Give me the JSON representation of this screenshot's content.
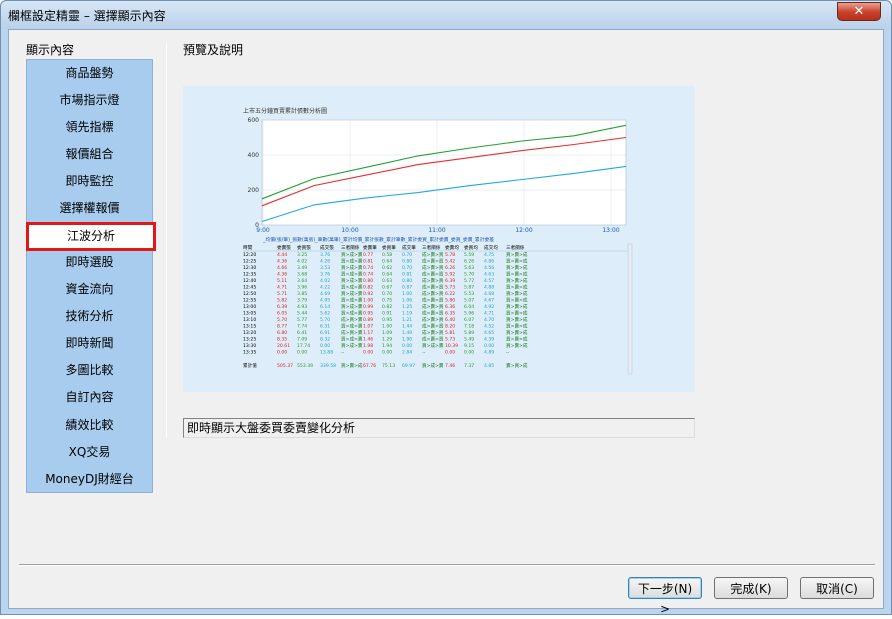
{
  "window": {
    "title": "欄框設定精靈 – 選擇顯示內容",
    "close_glyph": "✕"
  },
  "left_panel": {
    "label": "顯示內容",
    "items": [
      {
        "label": "商品盤勢"
      },
      {
        "label": "市場指示燈"
      },
      {
        "label": "領先指標"
      },
      {
        "label": "報價組合"
      },
      {
        "label": "即時監控"
      },
      {
        "label": "選擇權報價"
      },
      {
        "label": "江波分析",
        "selected": true
      },
      {
        "label": "即時選股"
      },
      {
        "label": "資金流向"
      },
      {
        "label": "技術分析"
      },
      {
        "label": "即時新聞"
      },
      {
        "label": "多圖比較"
      },
      {
        "label": "自訂內容"
      },
      {
        "label": "績效比較"
      },
      {
        "label": "XQ交易"
      },
      {
        "label": "MoneyDJ財經台"
      }
    ]
  },
  "right_panel": {
    "label": "預覽及說明",
    "description": "即時顯示大盤委買委賣變化分析"
  },
  "preview": {
    "title": "上市五分鐘買賣累計張數分析圖",
    "legend_text": "_均價(張/筆)_張數(萬張)_筆數(萬筆)_累計均價_累計張數_累計筆數_累計委買_累計委賣_委買_委賣_累計委差",
    "chart_data": {
      "type": "line",
      "x": [
        "9:00",
        "10:00",
        "11:00",
        "12:00",
        "13:00"
      ],
      "ylim": [
        0,
        600
      ],
      "yticks": [
        0,
        200,
        400,
        600
      ],
      "series": [
        {
          "color": "#22a033",
          "values": [
            150,
            265,
            330,
            395,
            440,
            480,
            510,
            570
          ]
        },
        {
          "color": "#e82c2c",
          "values": [
            110,
            225,
            285,
            345,
            385,
            425,
            460,
            500
          ]
        },
        {
          "color": "#22a8e0",
          "values": [
            20,
            115,
            155,
            185,
            225,
            260,
            295,
            335
          ]
        }
      ]
    },
    "table": {
      "headers": [
        "時間",
        "委賣張",
        "委買張",
        "成交張",
        "三者關係",
        "委賣筆",
        "委買筆",
        "成交筆",
        "三者關係",
        "委賣均",
        "委買均",
        "成交均",
        "三者關係"
      ],
      "rows": [
        [
          "12:20",
          "4.44",
          "3.25",
          "3.76",
          "買>成>賣",
          "0.77",
          "0.58",
          "0.70",
          "成>賣>買",
          "5.78",
          "5.59",
          "4.75",
          "買>賣>成"
        ],
        [
          "12:25",
          "4.36",
          "4.02",
          "4.26",
          "買>成>賣",
          "0.81",
          "0.64",
          "0.80",
          "成>賣>買",
          "5.42",
          "6.26",
          "4.86",
          "買>賣>成"
        ],
        [
          "12:30",
          "4.66",
          "3.49",
          "3.53",
          "買>成>賣",
          "0.74",
          "0.62",
          "0.70",
          "成>賣>買",
          "6.26",
          "5.63",
          "4.56",
          "買>賣>成"
        ],
        [
          "12:35",
          "4.36",
          "3.68",
          "3.76",
          "買>成>賣",
          "0.74",
          "0.64",
          "0.81",
          "成>賣>買",
          "5.92",
          "5.70",
          "4.63",
          "買>賣>成"
        ],
        [
          "12:40",
          "5.11",
          "3.64",
          "4.02",
          "買>成>賣",
          "0.80",
          "0.63",
          "0.80",
          "成>賣>買",
          "6.39",
          "5.77",
          "4.57",
          "買>賣>成"
        ],
        [
          "12:45",
          "4.71",
          "3.96",
          "4.22",
          "買>成>賣",
          "0.82",
          "0.67",
          "0.87",
          "成>賣>買",
          "5.73",
          "5.87",
          "4.88",
          "買>賣>成"
        ],
        [
          "12:50",
          "5.71",
          "3.85",
          "4.69",
          "買>成>賣",
          "0.92",
          "0.70",
          "1.00",
          "成>賣>買",
          "6.22",
          "5.53",
          "4.68",
          "買>賣>成"
        ],
        [
          "12:55",
          "5.82",
          "3.79",
          "4.95",
          "買>成>賣",
          "1.00",
          "0.75",
          "1.06",
          "成>賣>買",
          "5.80",
          "5.07",
          "4.67",
          "買>賣>成"
        ],
        [
          "13:00",
          "6.39",
          "4.93",
          "6.14",
          "買>成>賣",
          "0.99",
          "0.82",
          "1.25",
          "成>賣>買",
          "6.36",
          "6.04",
          "4.92",
          "買>賣>成"
        ],
        [
          "13:05",
          "6.05",
          "5.44",
          "5.62",
          "買>成>賣",
          "0.95",
          "0.91",
          "1.19",
          "成>賣>買",
          "6.35",
          "5.96",
          "4.71",
          "買>賣>成"
        ],
        [
          "13:10",
          "5.70",
          "5.77",
          "5.70",
          "成>買>賣",
          "0.89",
          "0.95",
          "1.21",
          "成>賣>買",
          "6.40",
          "6.07",
          "4.70",
          "買>賣>成"
        ],
        [
          "13:15",
          "8.77",
          "7.74",
          "6.31",
          "買>成>賣",
          "1.07",
          "1.00",
          "1.44",
          "成>賣>買",
          "8.20",
          "7.18",
          "4.52",
          "買>賣>成"
        ],
        [
          "13:20",
          "6.80",
          "6.41",
          "6.91",
          "成>買>賣",
          "1.17",
          "1.09",
          "1.49",
          "成>賣>買",
          "5.81",
          "5.89",
          "4.65",
          "買>賣>成"
        ],
        [
          "13:25",
          "8.35",
          "7.09",
          "8.32",
          "買>成>賣",
          "1.46",
          "1.29",
          "1.90",
          "成>賣>買",
          "5.73",
          "5.49",
          "4.39",
          "買>賣>成"
        ],
        [
          "13:30",
          "20.61",
          "17.74",
          "0.00",
          "買>成>賣",
          "1.98",
          "1.94",
          "0.00",
          "買>成>賣",
          "10.39",
          "9.15",
          "0.00",
          "買>賣>成"
        ],
        [
          "13:35",
          "0.00",
          "0.00",
          "13.88",
          "--",
          "0.00",
          "0.00",
          "2.84",
          "--",
          "0.00",
          "0.00",
          "4.89",
          "--"
        ]
      ],
      "total_row": [
        "累計值",
        "505.37",
        "553.39",
        "339.58",
        "買>賣>成",
        "67.76",
        "75.13",
        "69.97",
        "買>成>賣",
        "7.46",
        "7.37",
        "4.85",
        "賣>買>成"
      ]
    }
  },
  "buttons": {
    "next": "下一步(N) >",
    "finish": "完成(K)",
    "cancel": "取消(C)"
  }
}
